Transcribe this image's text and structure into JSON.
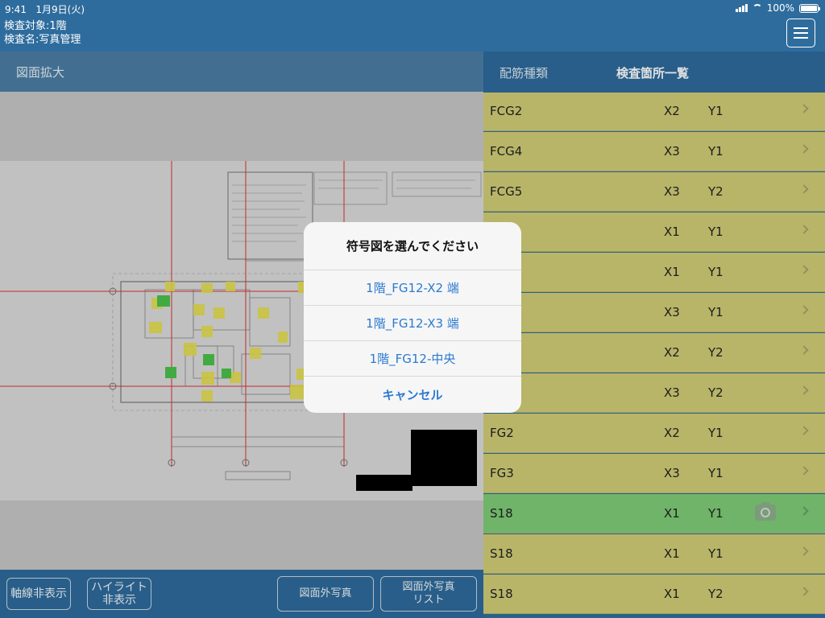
{
  "status_bar": {
    "time": "9:41",
    "date": "1月9日(火)",
    "battery": "100%",
    "battery_level": 1.0
  },
  "header": {
    "target": "検査対象:1階",
    "name": "検査名:写真管理",
    "menu_icon": "hamburger-menu-icon"
  },
  "left_panel": {
    "title": "図面拡大"
  },
  "bottom_buttons": {
    "axis": "軸線非表示",
    "highlight_1": "ハイライト",
    "highlight_2": "非表示",
    "outside_photo": "図面外写真",
    "outside_list_1": "図面外写真",
    "outside_list_2": "リスト"
  },
  "right_panel": {
    "tab_rebar": "配筋種類",
    "tab_list": "検査箇所一覧",
    "rows": [
      {
        "name": "FCG2",
        "x": "X2",
        "y": "Y1",
        "active": false,
        "camera": false
      },
      {
        "name": "FCG4",
        "x": "X3",
        "y": "Y1",
        "active": false,
        "camera": false
      },
      {
        "name": "FCG5",
        "x": "X3",
        "y": "Y2",
        "active": false,
        "camera": false
      },
      {
        "name": "",
        "x": "X1",
        "y": "Y1",
        "active": false,
        "camera": false
      },
      {
        "name": "",
        "x": "X1",
        "y": "Y1",
        "active": false,
        "camera": false
      },
      {
        "name": "",
        "x": "X3",
        "y": "Y1",
        "active": false,
        "camera": false
      },
      {
        "name": "",
        "x": "X2",
        "y": "Y2",
        "active": false,
        "camera": false
      },
      {
        "name": "",
        "x": "X3",
        "y": "Y2",
        "active": false,
        "camera": false
      },
      {
        "name": "FG2",
        "x": "X2",
        "y": "Y1",
        "active": false,
        "camera": false
      },
      {
        "name": "FG3",
        "x": "X3",
        "y": "Y1",
        "active": false,
        "camera": false
      },
      {
        "name": "S18",
        "x": "X1",
        "y": "Y1",
        "active": true,
        "camera": true
      },
      {
        "name": "S18",
        "x": "X1",
        "y": "Y1",
        "active": false,
        "camera": false
      },
      {
        "name": "S18",
        "x": "X1",
        "y": "Y2",
        "active": false,
        "camera": false
      }
    ]
  },
  "dialog": {
    "title": "符号図を選んでください",
    "options": [
      "1階_FG12-X2 端",
      "1階_FG12-X3 端",
      "1階_FG12-中央"
    ],
    "cancel": "キャンセル"
  }
}
